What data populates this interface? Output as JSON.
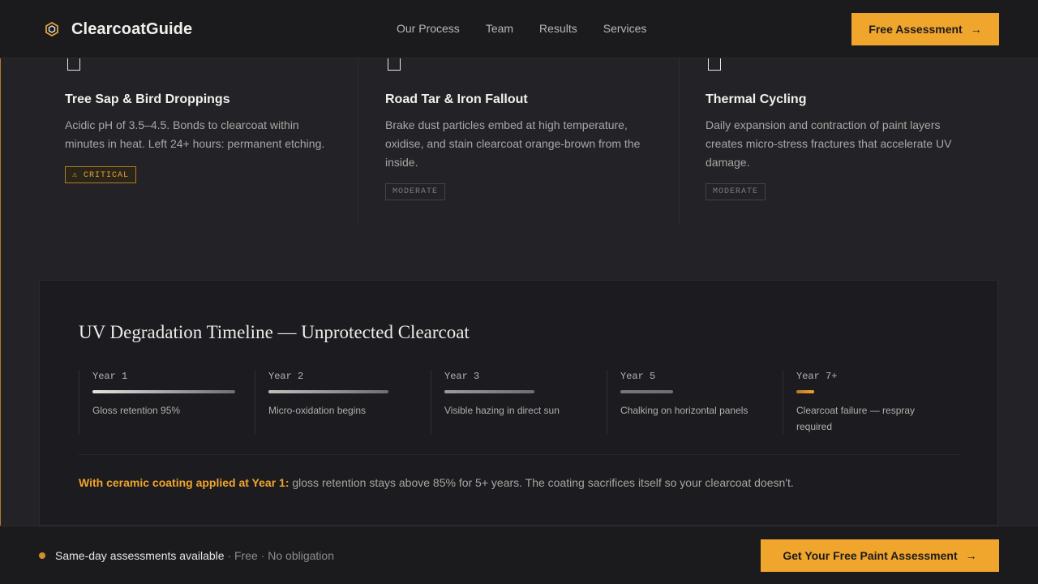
{
  "header": {
    "brand": "ClearcoatGuide",
    "logo_icon": "hexagon-icon",
    "nav": [
      "Our Process",
      "Team",
      "Results",
      "Services"
    ],
    "cta": "Free Assessment",
    "cta_icon": "arrow-right-icon"
  },
  "threats": [
    {
      "icon": "square-icon",
      "title": "Tree Sap & Bird Droppings",
      "description": "Acidic pH of 3.5–4.5. Bonds to clearcoat within minutes in heat. Left 24+ hours: permanent etching.",
      "badge": "⚠ CRITICAL"
    },
    {
      "icon": "square-icon",
      "title": "Road Tar & Iron Fallout",
      "description": "Brake dust particles embed at high temperature, oxidise, and stain clearcoat orange-brown from the inside.",
      "badge": "MODERATE"
    },
    {
      "icon": "square-icon",
      "title": "Thermal Cycling",
      "description": "Daily expansion and contraction of paint layers creates micro-stress fractures that accelerate UV damage.",
      "badge": "MODERATE"
    }
  ],
  "timeline": {
    "title": "UV Degradation Timeline — Unprotected Clearcoat",
    "stages": [
      {
        "year": "Year 1",
        "text": "Gloss retention 95%",
        "level": 0.95
      },
      {
        "year": "Year 2",
        "text": "Micro-oxidation begins",
        "level": 0.8
      },
      {
        "year": "Year 3",
        "text": "Visible hazing in direct sun",
        "level": 0.6
      },
      {
        "year": "Year 5",
        "text": "Chalking on horizontal panels",
        "level": 0.35
      },
      {
        "year": "Year 7+",
        "text": "Clearcoat failure — respray required",
        "level": 0.12
      }
    ],
    "note_highlight": "With ceramic coating applied at Year 1:",
    "note_text": " gloss retention stays above 85% for 5+ years. The coating sacrifices itself so your clearcoat doesn't."
  },
  "bottom_bar": {
    "status": "Same-day assessments available",
    "sep1": " · ",
    "item1": "Free",
    "sep2": " · ",
    "item2": "No obligation",
    "cta": "Get Your Free Paint Assessment",
    "cta_icon": "arrow-right-icon"
  },
  "colors": {
    "accent": "#f0a52c",
    "background": "#232227",
    "panel": "#1c1b1f"
  }
}
